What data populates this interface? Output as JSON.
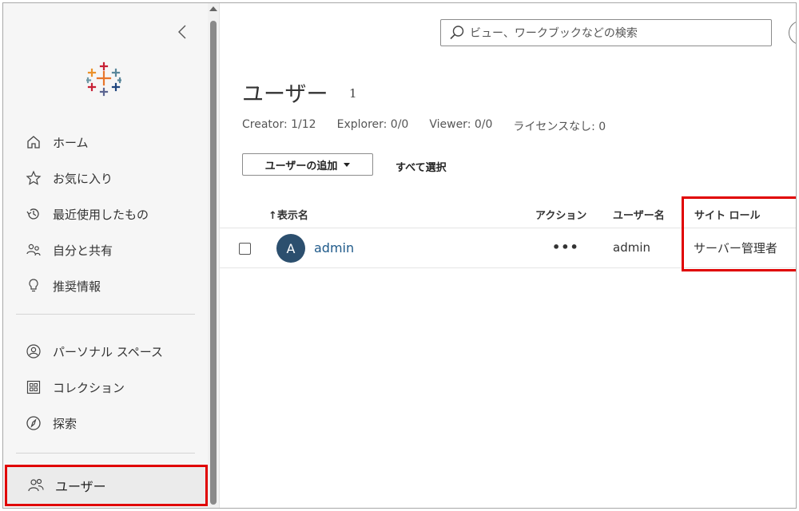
{
  "sidebar": {
    "items": [
      {
        "label": "ホーム",
        "icon": "home-icon"
      },
      {
        "label": "お気に入り",
        "icon": "star-icon"
      },
      {
        "label": "最近使用したもの",
        "icon": "history-icon"
      },
      {
        "label": "自分と共有",
        "icon": "shared-users-icon"
      },
      {
        "label": "推奨情報",
        "icon": "lightbulb-icon"
      },
      {
        "label": "パーソナル スペース",
        "icon": "person-circle-icon"
      },
      {
        "label": "コレクション",
        "icon": "collection-icon"
      },
      {
        "label": "探索",
        "icon": "compass-icon"
      },
      {
        "label": "ユーザー",
        "icon": "users-icon"
      }
    ]
  },
  "search": {
    "placeholder": "ビュー、ワークブックなどの検索"
  },
  "page": {
    "title": "ユーザー",
    "count": "1",
    "licenses": [
      "Creator: 1/12",
      "Explorer: 0/0",
      "Viewer: 0/0",
      "ライセンスなし: 0"
    ],
    "add_user_label": "ユーザーの追加",
    "select_all_label": "すべて選択"
  },
  "table": {
    "columns": {
      "display_name": "↑表示名",
      "action": "アクション",
      "username": "ユーザー名",
      "site_role": "サイト ロール"
    },
    "rows": [
      {
        "avatar_initial": "A",
        "display_name": "admin",
        "action": "•••",
        "username": "admin",
        "site_role": "サーバー管理者"
      }
    ]
  },
  "colors": {
    "highlight": "#e00000",
    "link": "#1f5a8a",
    "avatar_bg": "#2c4f6e"
  }
}
